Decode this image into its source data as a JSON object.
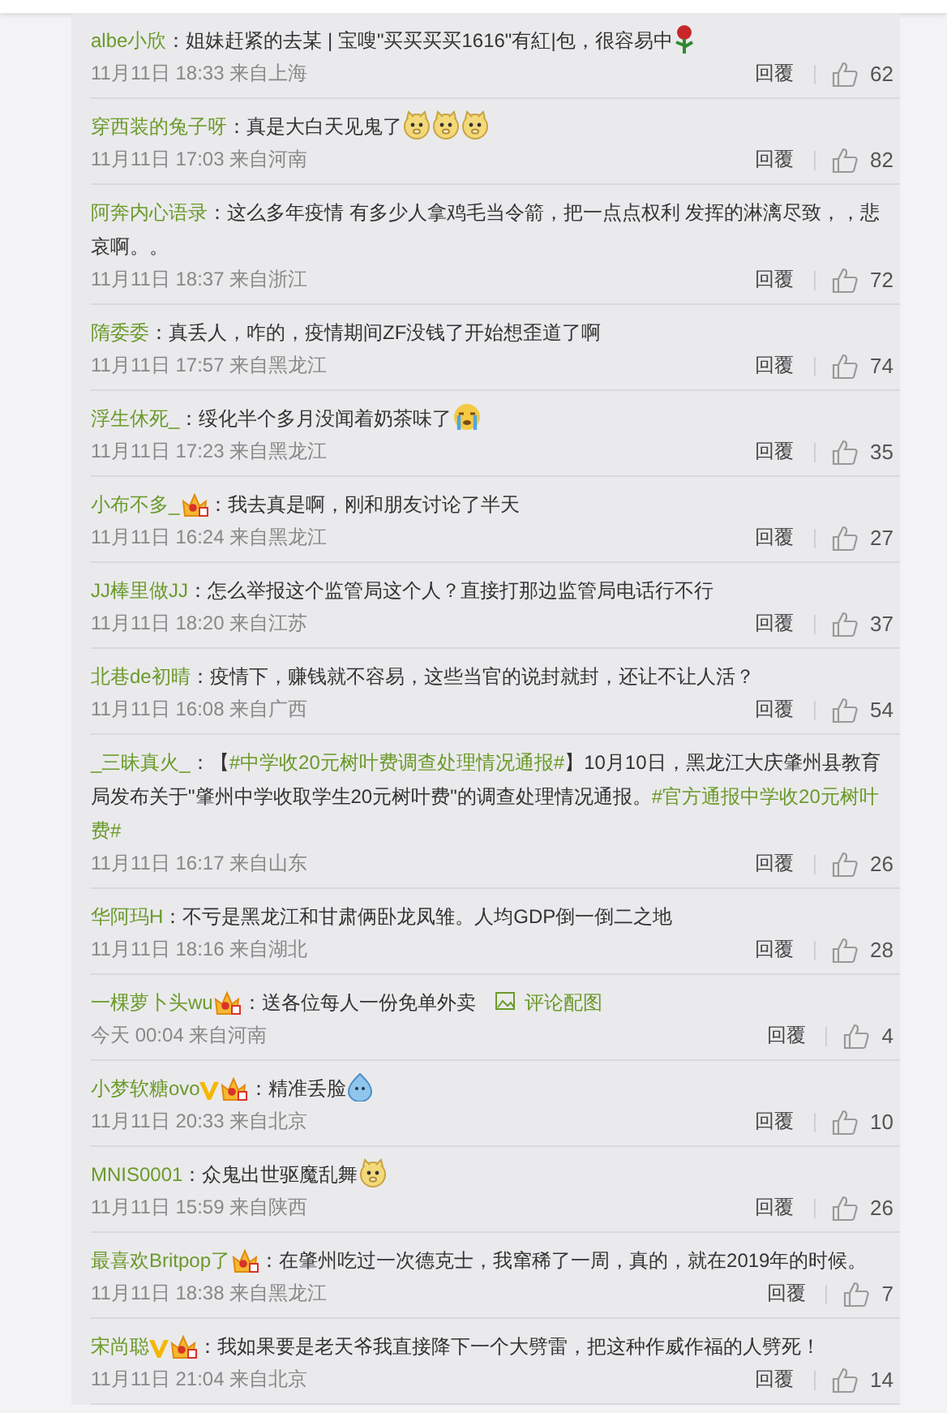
{
  "comments": [
    {
      "user": "albe小欣",
      "verified": false,
      "vip": false,
      "body": [
        {
          "kind": "text",
          "text": "：姐妹赶紧的去某 | 宝嗖\"买买买买1616\"有紅|包，很容易中"
        },
        {
          "kind": "rose"
        }
      ],
      "time": "11月11日 18:33 来自上海",
      "reply": "回覆",
      "likes": "62"
    },
    {
      "user": "穿西装的兔子呀",
      "verified": false,
      "vip": false,
      "body": [
        {
          "kind": "text",
          "text": "：真是大白天见鬼了"
        },
        {
          "kind": "doge"
        },
        {
          "kind": "doge"
        },
        {
          "kind": "doge"
        }
      ],
      "time": "11月11日 17:03 来自河南",
      "reply": "回覆",
      "likes": "82"
    },
    {
      "user": "阿奔内心语录",
      "verified": false,
      "vip": false,
      "body": [
        {
          "kind": "text",
          "text": "：这么多年疫情 有多少人拿鸡毛当令箭，把一点点权利 发挥的淋漓尽致，，悲哀啊。。"
        }
      ],
      "time": "11月11日 18:37 来自浙江",
      "reply": "回覆",
      "likes": "72"
    },
    {
      "user": "隋委委",
      "verified": false,
      "vip": false,
      "body": [
        {
          "kind": "text",
          "text": "：真丢人，咋的，疫情期间ZF没钱了开始想歪道了啊"
        }
      ],
      "time": "11月11日 17:57 来自黑龙江",
      "reply": "回覆",
      "likes": "74"
    },
    {
      "user": "浮生休死_",
      "verified": false,
      "vip": false,
      "body": [
        {
          "kind": "text",
          "text": "：绥化半个多月没闻着奶茶味了"
        },
        {
          "kind": "cry"
        }
      ],
      "time": "11月11日 17:23 来自黑龙江",
      "reply": "回覆",
      "likes": "35"
    },
    {
      "user": "小布不多_",
      "verified": false,
      "vip": true,
      "body": [
        {
          "kind": "text",
          "text": "：我去真是啊，刚和朋友讨论了半天"
        }
      ],
      "time": "11月11日 16:24 来自黑龙江",
      "reply": "回覆",
      "likes": "27"
    },
    {
      "user": "JJ棒里做JJ",
      "verified": false,
      "vip": false,
      "body": [
        {
          "kind": "text",
          "text": "：怎么举报这个监管局这个人？直接打那边监管局电话行不行"
        }
      ],
      "time": "11月11日 18:20 来自江苏",
      "reply": "回覆",
      "likes": "37"
    },
    {
      "user": "北巷de初晴",
      "verified": false,
      "vip": false,
      "body": [
        {
          "kind": "text",
          "text": "：疫情下，赚钱就不容易，这些当官的说封就封，还让不让人活？"
        }
      ],
      "time": "11月11日 16:08 来自广西",
      "reply": "回覆",
      "likes": "54"
    },
    {
      "user": "_三昧真火_",
      "verified": false,
      "vip": false,
      "body": [
        {
          "kind": "text",
          "text": "：【"
        },
        {
          "kind": "hashtag",
          "text": "#中学收20元树叶费调查处理情况通报#"
        },
        {
          "kind": "text",
          "text": "】10月10日，黑龙江大庆肇州县教育局发布关于\"肇州中学收取学生20元树叶费\"的调查处理情况通报。"
        },
        {
          "kind": "hashtag",
          "text": "#官方通报中学收20元树叶费#"
        }
      ],
      "time": "11月11日 16:17 来自山东",
      "reply": "回覆",
      "likes": "26"
    },
    {
      "user": "华阿玛H",
      "verified": false,
      "vip": false,
      "body": [
        {
          "kind": "text",
          "text": "：不亏是黑龙江和甘肃俩卧龙凤雏。人均GDP倒一倒二之地"
        }
      ],
      "time": "11月11日 18:16 来自湖北",
      "reply": "回覆",
      "likes": "28"
    },
    {
      "user": "一棵萝卜头wu",
      "verified": false,
      "vip": true,
      "body": [
        {
          "kind": "text",
          "text": "：送各位每人一份免单外卖"
        },
        {
          "kind": "image-link",
          "text": "评论配图"
        }
      ],
      "time": "今天 00:04 来自河南",
      "reply": "回覆",
      "likes": "4"
    },
    {
      "user": "小梦软糖ovo",
      "verified": true,
      "vip": true,
      "body": [
        {
          "kind": "text",
          "text": "：精准丢脸"
        },
        {
          "kind": "splash"
        }
      ],
      "time": "11月11日 20:33 来自北京",
      "reply": "回覆",
      "likes": "10"
    },
    {
      "user": "MNIS0001",
      "verified": false,
      "vip": false,
      "body": [
        {
          "kind": "text",
          "text": "：众鬼出世驱魔乱舞"
        },
        {
          "kind": "doge"
        }
      ],
      "time": "11月11日 15:59 来自陕西",
      "reply": "回覆",
      "likes": "26"
    },
    {
      "user": "最喜欢Britpop了",
      "verified": false,
      "vip": true,
      "body": [
        {
          "kind": "text",
          "text": "：在肇州吃过一次德克士，我窜稀了一周，真的，就在2019年的时候。"
        }
      ],
      "time": "11月11日 18:38 来自黑龙江",
      "reply": "回覆",
      "likes": "7"
    },
    {
      "user": "宋尚聪",
      "verified": true,
      "vip": true,
      "body": [
        {
          "kind": "text",
          "text": "：我如果要是老天爷我直接降下一个大劈雷，把这种作威作福的人劈死！"
        }
      ],
      "time": "11月11日 21:04 来自北京",
      "reply": "回覆",
      "likes": "14"
    }
  ]
}
